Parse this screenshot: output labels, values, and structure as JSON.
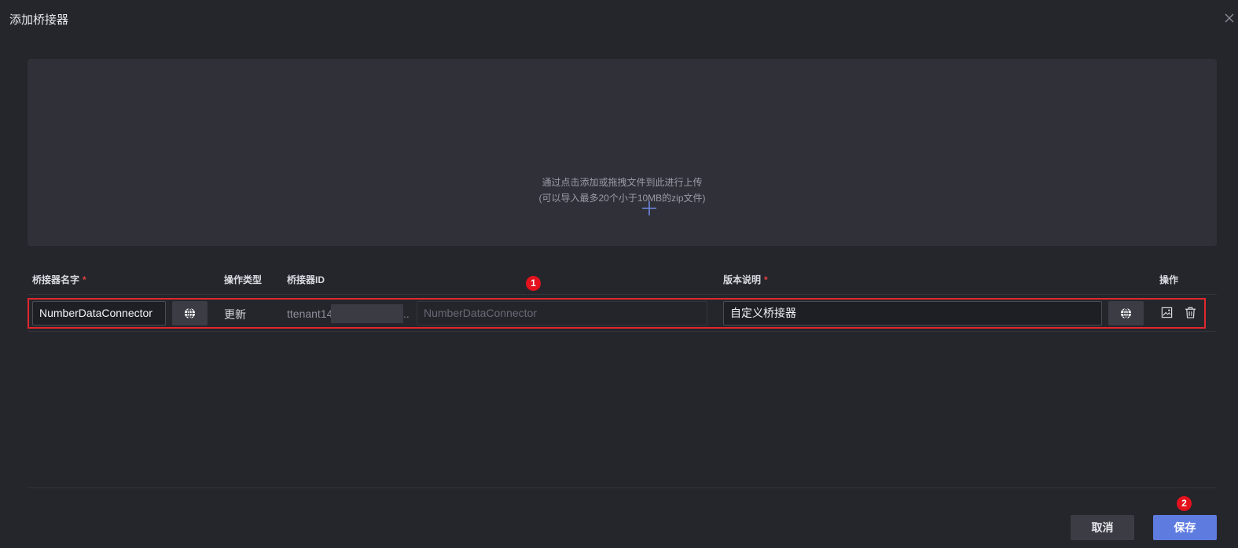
{
  "dialog": {
    "title": "添加桥接器"
  },
  "upload": {
    "hint_line1": "通过点击添加或拖拽文件到此进行上传",
    "hint_line2": "(可以导入最多20个小于10MB的zip文件)"
  },
  "table": {
    "headers": {
      "name": "桥接器名字",
      "op_type": "操作类型",
      "bridge_id": "桥接器ID",
      "version_desc": "版本说明",
      "actions": "操作"
    },
    "required_mark": "*",
    "rows": [
      {
        "name_value": "NumberDataConnector",
        "op_type": "更新",
        "bridge_id_prefix": "ttenant14",
        "bridge_id_ellipsis": "..",
        "bridge_id_placeholder": "NumberDataConnector",
        "version_desc_value": "自定义桥接器"
      }
    ]
  },
  "badges": {
    "first": "1",
    "second": "2"
  },
  "footer": {
    "cancel_label": "取消",
    "save_label": "保存"
  },
  "icons": {
    "close": "close-icon",
    "upload": "plus-icon",
    "globe": "globe-icon",
    "image": "image-icon",
    "delete": "trash-icon"
  },
  "colors": {
    "background": "#25262c",
    "upload_area": "#2f3038",
    "primary": "#5e7ce0",
    "highlight_border": "#e0282d",
    "badge": "#e3121c",
    "required": "#e2433f"
  }
}
